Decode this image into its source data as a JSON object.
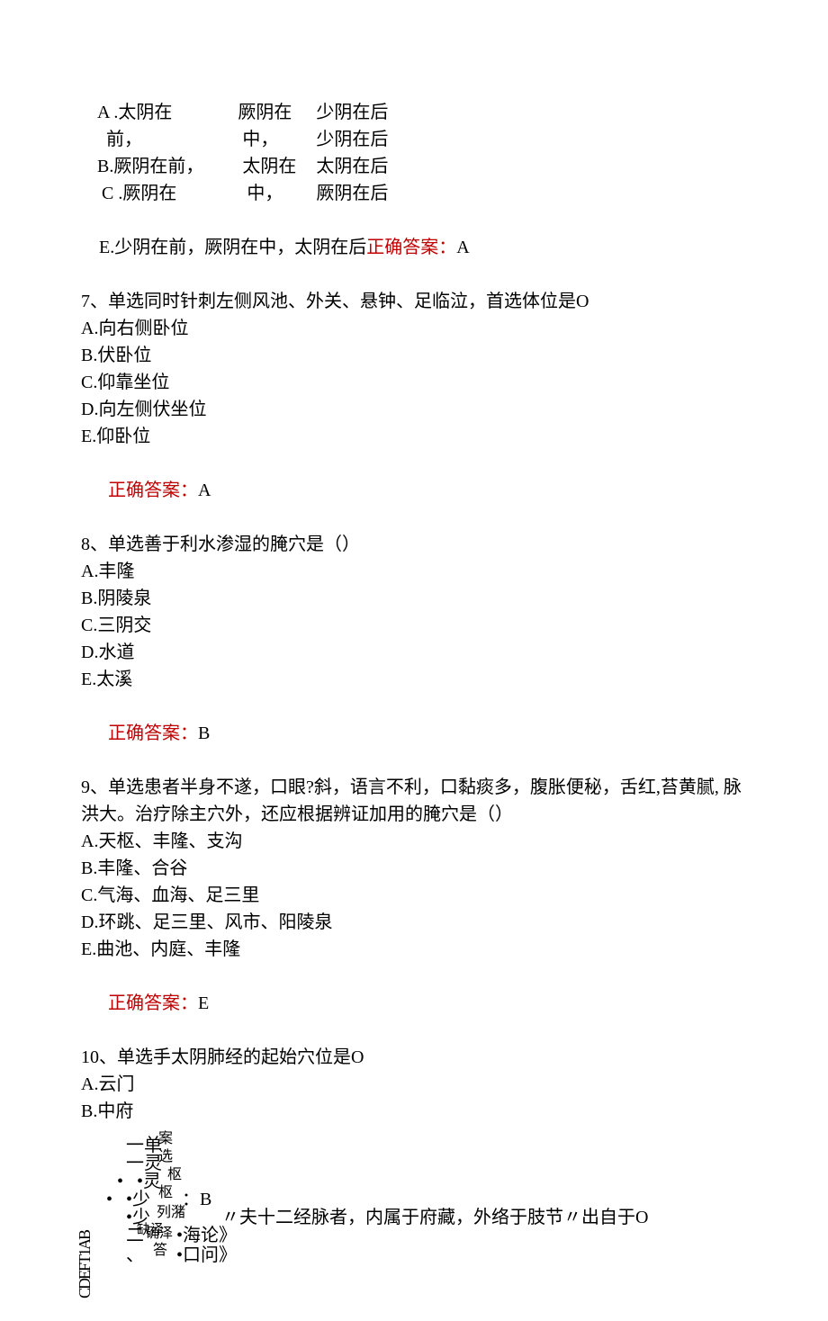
{
  "q6": {
    "col1": [
      "A .太阴在",
      "  前，",
      "B.厥阴在前，",
      " C .厥阴在"
    ],
    "col2": [
      "厥阴在",
      " 中，",
      " 太阴在",
      "  中，"
    ],
    "col3": [
      "少阴在后",
      "少阴在后",
      "太阴在后",
      "厥阴在后"
    ],
    "lineE_pre": "E.少阴在前，厥阴在中，太阴在后",
    "ans_label": "正确答案：",
    "ans_val": "A"
  },
  "q7": {
    "stem": "7、单选同时针刺左侧风池、外关、悬钟、足临泣，首选体位是O",
    "opts": [
      "A.向右侧卧位",
      "B.伏卧位",
      "C.仰靠坐位",
      "D.向左侧伏坐位",
      "E.仰卧位"
    ],
    "ans_label": "正确答案：",
    "ans_val": "A"
  },
  "q8": {
    "stem": "8、单选善于利水渗湿的腌穴是（）",
    "opts": [
      "A.丰隆",
      "B.阴陵泉",
      "C.三阴交",
      "D.水道",
      "E.太溪"
    ],
    "ans_label": "正确答案：",
    "ans_val": "B"
  },
  "q9": {
    "stem": "9、单选患者半身不遂，口眼?斜，语言不利，口黏痰多，腹胀便秘，舌红,苔黄腻, 脉洪大。治疗除主穴外，还应根据辨证加用的腌穴是（）",
    "opts": [
      "A.天枢、丰隆、支沟",
      "B.丰隆、合谷",
      "C.气海、血海、足三里",
      "D.环跳、足三里、风市、阳陵泉",
      "E.曲池、内庭、丰隆"
    ],
    "ans_label": "正确答案：",
    "ans_val": "E"
  },
  "q10": {
    "stem": "10、单选手太阴肺经的起始穴位是O",
    "opts": [
      "A.云门",
      "B.中府"
    ]
  },
  "bottom": {
    "rot": "CDEFT1AB",
    "l1a": "一单",
    "l1b": "案",
    "l2a": "一灵",
    "l2b": "选",
    "l3a": "•灵",
    "l3b": "枢",
    "l4a": "•少",
    "l4b": "枢",
    "l4c": "：B",
    "l5a": "•少",
    "l5b": "列潴",
    "phrase": "〃夫十二经脉者，内属于府藏，外络于肢节〃出自于O",
    "l6a": "二",
    "l6b": "缺泽",
    "l6c": "确泽",
    "l6d": "•海论》",
    "l7a": "、",
    "l7b": "答",
    "l7c": "•口问》"
  }
}
